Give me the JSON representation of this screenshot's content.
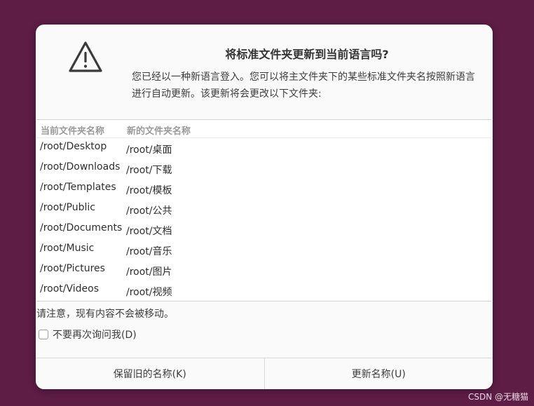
{
  "dialog": {
    "title": "将标准文件夹更新到当前语言吗?",
    "message": "您已经以一种新语言登入。您可以将主文件夹下的某些标准文件夹名按照新语言进行自动更新。该更新将会更改以下文件夹:",
    "icon": "warning-triangle-icon",
    "table": {
      "columns": [
        "当前文件夹名称",
        "新的文件夹名称"
      ],
      "rows": [
        {
          "current": "/root/Desktop",
          "new": "/root/桌面"
        },
        {
          "current": "/root/Downloads",
          "new": "/root/下载"
        },
        {
          "current": "/root/Templates",
          "new": "/root/模板"
        },
        {
          "current": "/root/Public",
          "new": "/root/公共"
        },
        {
          "current": "/root/Documents",
          "new": "/root/文档"
        },
        {
          "current": "/root/Music",
          "new": "/root/音乐"
        },
        {
          "current": "/root/Pictures",
          "new": "/root/图片"
        },
        {
          "current": "/root/Videos",
          "new": "/root/视频"
        }
      ]
    },
    "note": "请注意，现有内容不会被移动。",
    "checkbox": {
      "label": "不要再次询问我(D)",
      "checked": false
    },
    "buttons": {
      "keep": "保留旧的名称(K)",
      "update": "更新名称(U)"
    }
  },
  "watermark": "CSDN @无糖猫",
  "colors": {
    "background": "#5d1d45",
    "dialog": "#fafafa"
  }
}
